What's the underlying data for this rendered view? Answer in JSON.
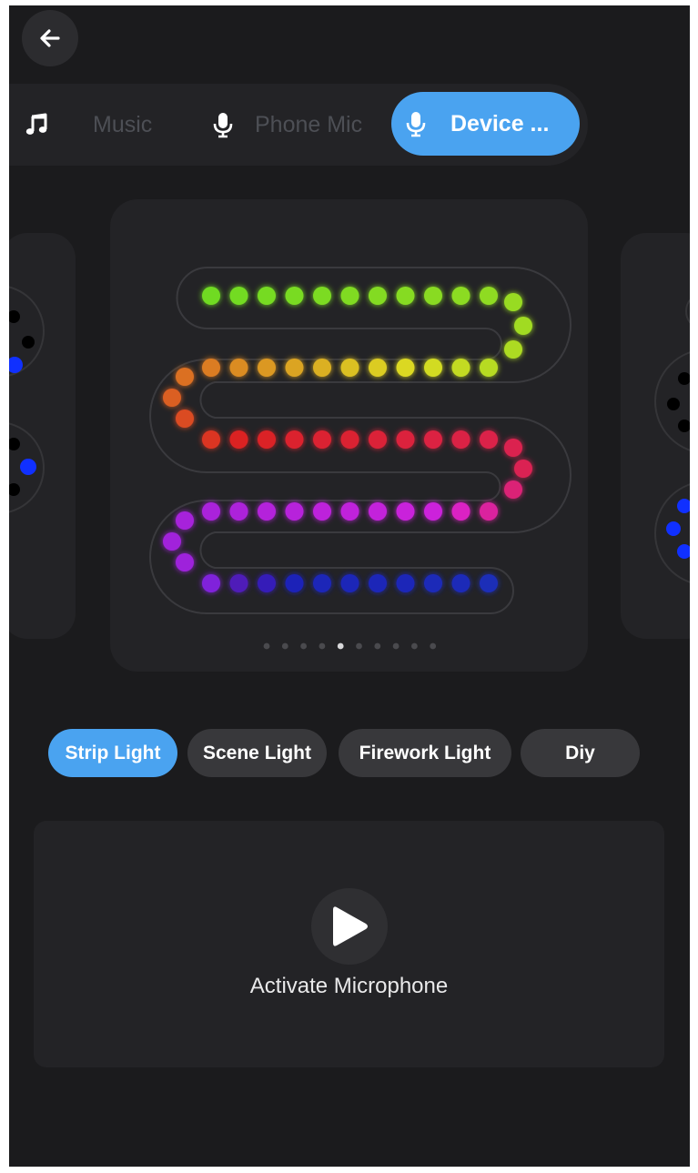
{
  "header": {
    "back_icon": "arrow-left-icon"
  },
  "source_tabs": [
    {
      "label": "Music",
      "icon": "music-note-icon",
      "active": false
    },
    {
      "label": "Phone Mic",
      "icon": "microphone-icon",
      "active": false
    },
    {
      "label": "Device ...",
      "icon": "microphone-icon",
      "active": true
    }
  ],
  "preview": {
    "page_count": 10,
    "active_page": 5
  },
  "modes": [
    {
      "label": "Strip Light",
      "active": true
    },
    {
      "label": "Scene Light",
      "active": false
    },
    {
      "label": "Firework Light",
      "active": false
    },
    {
      "label": "Diy",
      "active": false
    }
  ],
  "action": {
    "label": "Activate Microphone",
    "icon": "play-icon"
  },
  "colors": {
    "background": "#1b1b1d",
    "card": "#232326",
    "accent": "#4aa3f0",
    "chip_inactive": "#38383b"
  }
}
